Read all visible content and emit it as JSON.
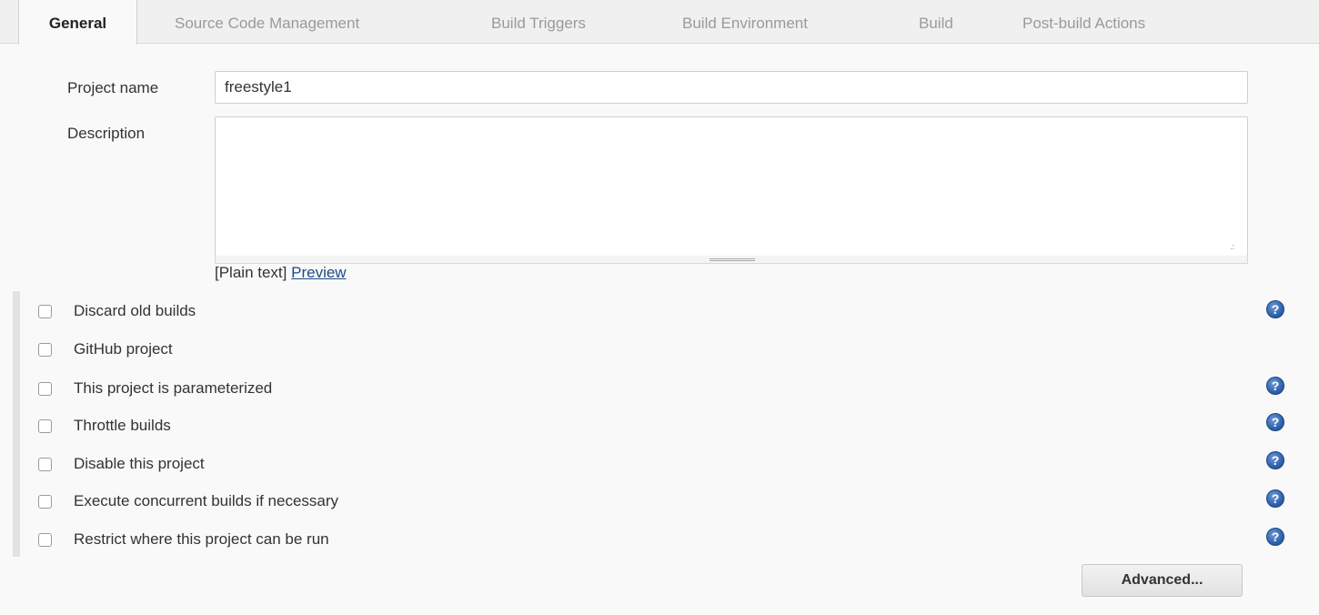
{
  "tabs": [
    {
      "label": "General",
      "active": true
    },
    {
      "label": "Source Code Management",
      "active": false
    },
    {
      "label": "Build Triggers",
      "active": false
    },
    {
      "label": "Build Environment",
      "active": false
    },
    {
      "label": "Build",
      "active": false
    },
    {
      "label": "Post-build Actions",
      "active": false
    }
  ],
  "form": {
    "project_name_label": "Project name",
    "project_name_value": "freestyle1",
    "description_label": "Description",
    "description_value": "",
    "markup_prefix": "[Plain text]",
    "preview_link": "Preview"
  },
  "options": [
    {
      "label": "Discard old builds",
      "checked": false,
      "help": true
    },
    {
      "label": "GitHub project",
      "checked": false,
      "help": false
    },
    {
      "label": "This project is parameterized",
      "checked": false,
      "help": true
    },
    {
      "label": "Throttle builds",
      "checked": false,
      "help": true
    },
    {
      "label": "Disable this project",
      "checked": false,
      "help": true
    },
    {
      "label": "Execute concurrent builds if necessary",
      "checked": false,
      "help": true
    },
    {
      "label": "Restrict where this project can be run",
      "checked": false,
      "help": true
    }
  ],
  "help_glyph": "?",
  "advanced_button": "Advanced...",
  "colors": {
    "link": "#204a87",
    "help_icon": "#2f62ad",
    "active_tab_text": "#222222",
    "inactive_tab_text": "#9a9a9a"
  },
  "icons": {
    "help": "help-circle-icon",
    "resize": "resize-grip-icon"
  }
}
